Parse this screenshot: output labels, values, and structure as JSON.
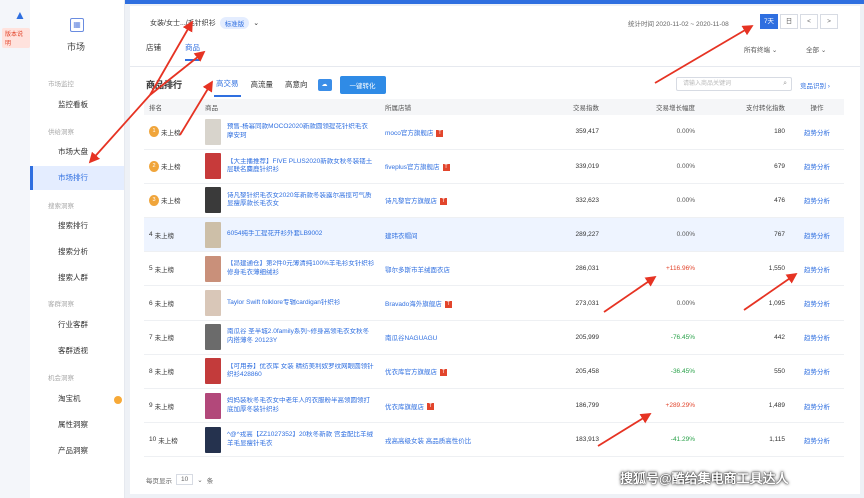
{
  "app": {
    "version_badge": "版本说明",
    "market_title": "市场"
  },
  "sidebar": {
    "groups": [
      {
        "label": "市场监控",
        "items": [
          "监控看板"
        ]
      },
      {
        "label": "供给洞察",
        "items": [
          "市场大盘",
          "市场排行"
        ]
      },
      {
        "label": "搜索洞察",
        "items": [
          "搜索排行",
          "搜索分析",
          "搜索人群"
        ]
      },
      {
        "label": "客群洞察",
        "items": [
          "行业客群",
          "客群透视"
        ]
      },
      {
        "label": "机会洞察",
        "items": [
          "淘宝机",
          "属性洞察",
          "产品洞察"
        ]
      }
    ],
    "active": "市场排行"
  },
  "header": {
    "category": "女装/女士.../毛针织衫",
    "tag": "标准版",
    "stats_time": "统计时间 2020-11-02 ~ 2020-11-08",
    "range": [
      "7天",
      "日",
      "<",
      ">"
    ],
    "tabs": [
      "店铺",
      "商品"
    ],
    "active_tab": "商品",
    "device_select": "所有终端",
    "region_select": "全部"
  },
  "section": {
    "title": "商品排行",
    "metric_tabs": [
      "高交易",
      "高流量",
      "高意向"
    ],
    "active_metric": "高交易",
    "convert_button": "一键转化",
    "search_placeholder": "请输入商品关键词",
    "note_link": "竞品识别"
  },
  "table": {
    "headers": [
      "排名",
      "商品",
      "所属店铺",
      "交易指数",
      "交易增长幅度",
      "支付转化指数",
      "操作"
    ],
    "rows": [
      {
        "rank": "1",
        "rank_label": "未上榜",
        "product": "预售-杨幂同款MOCO2020新款圆领提花针织毛衣 摩安珂",
        "shop": "moco官方旗舰店",
        "index": "359,417",
        "growth": "0.00%",
        "dir": "flat",
        "conv": "180",
        "op": "趋势分析",
        "thumb": "#d8d4cc"
      },
      {
        "rank": "2",
        "rank_label": "未上榜",
        "product": "【大主播推荐】FIVE PLUS2020新款女秋冬装镂土层联名麋鹿针织衫",
        "shop": "fiveplus官方旗舰店",
        "index": "339,019",
        "growth": "0.00%",
        "dir": "flat",
        "conv": "679",
        "op": "趋势分析",
        "thumb": "#c73a3a"
      },
      {
        "rank": "3",
        "rank_label": "未上榜",
        "product": "诗凡黎针织毛衣女2020年新款冬装露尔高揽可气质显瘦厚款长毛衣女",
        "shop": "诗凡黎官方旗舰店",
        "index": "332,623",
        "growth": "0.00%",
        "dir": "flat",
        "conv": "476",
        "op": "趋势分析",
        "thumb": "#3a3a3a"
      },
      {
        "rank": "4",
        "rank_label": "未上榜",
        "product": "6054纯手工提花开衫外套LB9002",
        "shop": "建玮衣帽间",
        "index": "289,227",
        "growth": "0.00%",
        "dir": "flat",
        "conv": "767",
        "op": "趋势分析",
        "thumb": "#cdbfa8",
        "highlight": true
      },
      {
        "rank": "5",
        "rank_label": "未上榜",
        "product": "【昂建通仓】第2件0元薄清纯100%羊毛衫女针织衫修身毛衣薄细绒衫",
        "shop": "鄂尔多斯市羊绒面衣店",
        "index": "286,031",
        "growth": "+116.96%",
        "dir": "up",
        "conv": "1,550",
        "op": "趋势分析",
        "thumb": "#c9907a"
      },
      {
        "rank": "6",
        "rank_label": "未上榜",
        "product": "Taylor Swift folklore专辑cardigan针织衫",
        "shop": "Bravado海外旗舰店",
        "index": "273,031",
        "growth": "0.00%",
        "dir": "flat",
        "conv": "1,095",
        "op": "趋势分析",
        "thumb": "#d9c7b8"
      },
      {
        "rank": "7",
        "rank_label": "未上榜",
        "product": "南瓜谷 圣半城2.0family系列~修身高领毛衣女秋冬内搭薄冬 20123Y",
        "shop": "南瓜谷NAGUAGU",
        "index": "205,999",
        "growth": "-76.45%",
        "dir": "down",
        "conv": "442",
        "op": "趋势分析",
        "thumb": "#6b6b6b"
      },
      {
        "rank": "8",
        "rank_label": "未上榜",
        "product": "【可用券】优衣库 女装 精纺美利奴罗纹网眼圆领针织衫428860",
        "shop": "优衣库官方旗舰店",
        "index": "205,458",
        "growth": "-36.45%",
        "dir": "down",
        "conv": "550",
        "op": "趋势分析",
        "thumb": "#c33b3b"
      },
      {
        "rank": "9",
        "rank_label": "未上榜",
        "product": "妈妈装秋冬毛衣女中老年人的衣服粉半高领圆领打底加厚冬装针织衫",
        "shop": "优衣库旗舰店",
        "index": "186,799",
        "growth": "+289.29%",
        "dir": "up",
        "conv": "1,489",
        "op": "趋势分析",
        "thumb": "#b2487a"
      },
      {
        "rank": "10",
        "rank_label": "未上榜",
        "product": "^@^戎高【ZZ1027352】20秋冬新款 宫金配比羊绒羊毛显瘦针毛衣",
        "shop": "戎高高级女装 高品质高性价比",
        "index": "183,913",
        "growth": "-41.29%",
        "dir": "down",
        "conv": "1,115",
        "op": "趋势分析",
        "thumb": "#25324e"
      }
    ]
  },
  "pager": {
    "prefix": "每页显示",
    "size": "10",
    "suffix": "条"
  },
  "watermark": "搜狐号@酷给集电商工具达人",
  "colors": {
    "accent": "#2f6fe0",
    "up": "#e2452c",
    "down": "#2aa24a",
    "arrow": "#e63323"
  }
}
